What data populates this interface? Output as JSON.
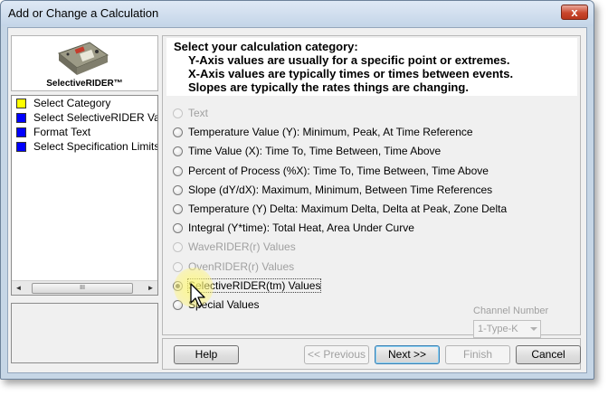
{
  "window": {
    "title": "Add or Change a Calculation",
    "close_glyph": "x"
  },
  "sidebar": {
    "logo_label": "SelectiveRIDER™",
    "steps": [
      {
        "label": "Select Category",
        "color": "#ffff00"
      },
      {
        "label": "Select SelectiveRIDER Values",
        "color": "#0000ff"
      },
      {
        "label": "Format Text",
        "color": "#0000ff"
      },
      {
        "label": "Select Specification Limits",
        "color": "#0000ff"
      }
    ],
    "scroll_left": "◄",
    "scroll_right": "►",
    "scroll_grip": "III"
  },
  "header": {
    "line1": "Select your calculation category:",
    "line2": "Y-Axis values are usually for a specific point or extremes.",
    "line3": "X-Axis values are typically times or times between events.",
    "line4": "Slopes are typically the rates things are changing."
  },
  "options": [
    {
      "label": "Text",
      "enabled": false,
      "checked": false
    },
    {
      "label": "Temperature Value (Y):  Minimum, Peak, At Time Reference",
      "enabled": true,
      "checked": false
    },
    {
      "label": "Time Value (X):  Time To, Time Between, Time Above",
      "enabled": true,
      "checked": false
    },
    {
      "label": "Percent of Process (%X):  Time To, Time Between, Time Above",
      "enabled": true,
      "checked": false
    },
    {
      "label": "Slope (dY/dX):  Maximum, Minimum, Between Time References",
      "enabled": true,
      "checked": false
    },
    {
      "label": "Temperature (Y) Delta:  Maximum Delta, Delta at Peak, Zone Delta",
      "enabled": true,
      "checked": false
    },
    {
      "label": "Integral (Y*time): Total Heat, Area Under Curve",
      "enabled": true,
      "checked": false
    },
    {
      "label": "WaveRIDER(r) Values",
      "enabled": false,
      "checked": false
    },
    {
      "label": "OvenRIDER(r) Values",
      "enabled": false,
      "checked": false
    },
    {
      "label": "SelectiveRIDER(tm) Values",
      "enabled": true,
      "checked": true
    },
    {
      "label": "Special  Values",
      "enabled": true,
      "checked": false
    }
  ],
  "channel": {
    "label": "Channel Number",
    "value": "1-Type-K"
  },
  "buttons": {
    "help": "Help",
    "previous": "<< Previous",
    "next": "Next >>",
    "finish": "Finish",
    "cancel": "Cancel"
  }
}
